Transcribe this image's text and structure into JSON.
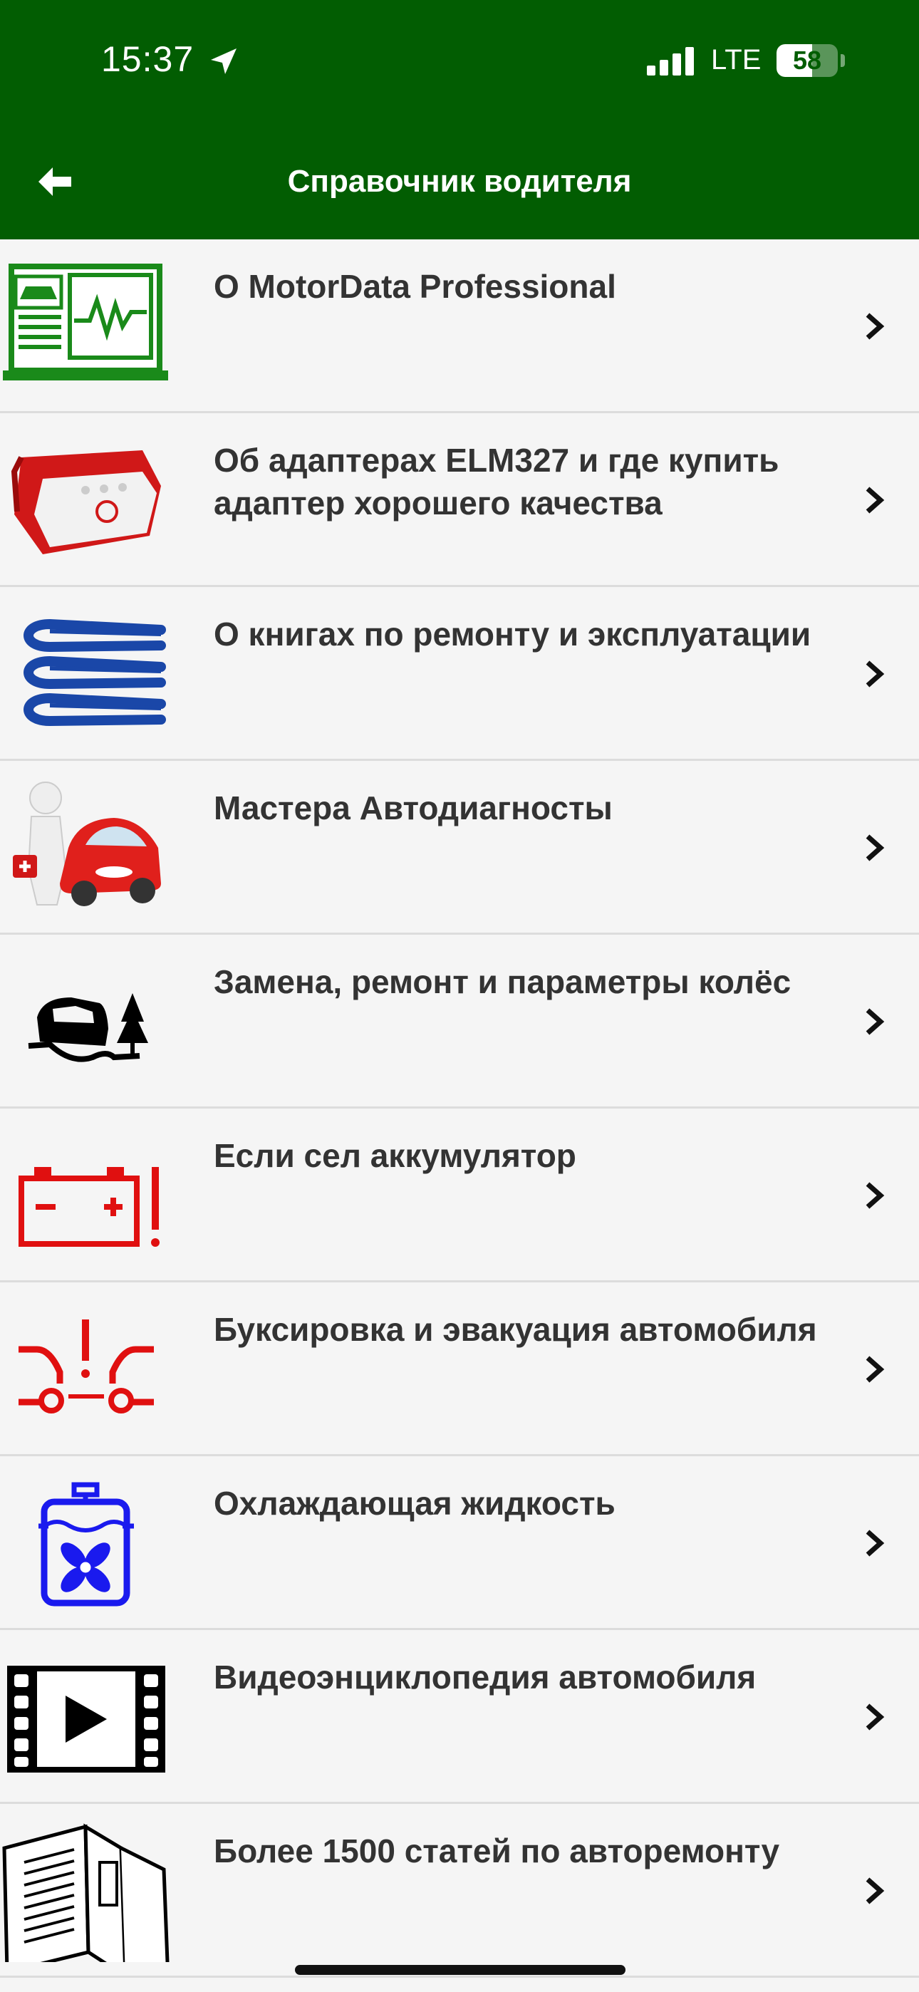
{
  "status_bar": {
    "time": "15:37",
    "network": "LTE",
    "battery_percent": "58",
    "battery_level": 0.58
  },
  "header": {
    "title": "Справочник водителя",
    "back_icon": "back-arrow-icon",
    "color": "#025d02"
  },
  "items": [
    {
      "label": "О MotorData Professional",
      "icon": "laptop-diagnostics-icon"
    },
    {
      "label": "Об адаптерах ELM327 и где купить адаптер хорошего качества",
      "icon": "obd-adapter-icon"
    },
    {
      "label": "О книгах по ремонту и эксплуатации",
      "icon": "books-icon"
    },
    {
      "label": "Мастера Автодиагносты",
      "icon": "car-doctor-icon"
    },
    {
      "label": "Замена, ремонт и параметры колёс",
      "icon": "car-skid-icon"
    },
    {
      "label": "Если сел аккумулятор",
      "icon": "battery-warning-icon"
    },
    {
      "label": "Буксировка и эвакуация автомобиля",
      "icon": "towing-icon"
    },
    {
      "label": "Охлаждающая жидкость",
      "icon": "coolant-icon"
    },
    {
      "label": "Видеоэнциклопедия автомобиля",
      "icon": "video-film-icon"
    },
    {
      "label": "Более 1500 статей по авторемонту",
      "icon": "book-open-icon"
    }
  ],
  "chevron_icon": "chevron-right-icon"
}
